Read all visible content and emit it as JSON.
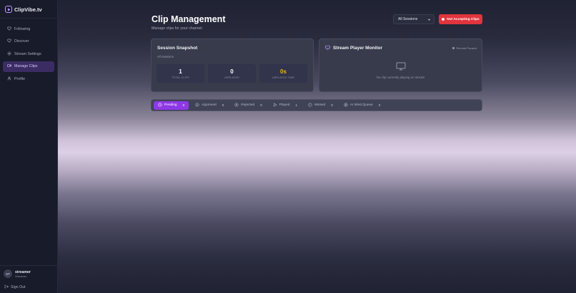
{
  "app": {
    "name": "ClipVibe.tv"
  },
  "sidebar": {
    "items": [
      {
        "label": "Following",
        "icon": "heart-icon",
        "active": false
      },
      {
        "label": "Discover",
        "icon": "heart-icon",
        "active": false
      },
      {
        "label": "Stream Settings",
        "icon": "gear-icon",
        "active": false
      },
      {
        "label": "Manage Clips",
        "icon": "video-icon",
        "active": true
      },
      {
        "label": "Profile",
        "icon": "user-icon",
        "active": false
      }
    ],
    "user": {
      "initials": "ST",
      "name": "streamer",
      "role": "Streamer"
    },
    "signout_label": "Sign Out"
  },
  "header": {
    "title": "Clip Management",
    "subtitle": "Manage clips for your channel",
    "session_select": {
      "value": "All Sessions"
    },
    "accept_button": {
      "label": "Not Accepting Clips",
      "color": "#e0353d"
    }
  },
  "session_snapshot": {
    "title": "Session Snapshot",
    "subtitle": "All Sessions",
    "stats": [
      {
        "value": "1",
        "label": "TOTAL CLIPS"
      },
      {
        "value": "0",
        "label": "UNPLAYED"
      },
      {
        "value": "0s",
        "label": "UNPLAYED TIME",
        "color": "#f2b51e"
      }
    ]
  },
  "monitor": {
    "title": "Stream Player Monitor",
    "badge": "Remote Paused",
    "empty_text": "No clip currently playing on stream"
  },
  "tabs": [
    {
      "label": "Pending",
      "count": "0",
      "icon": "clock-icon",
      "active": true
    },
    {
      "label": "Approved",
      "count": "0",
      "icon": "check-circle-icon",
      "active": false
    },
    {
      "label": "Rejected",
      "count": "0",
      "icon": "x-circle-icon",
      "active": false
    },
    {
      "label": "Played",
      "count": "1",
      "icon": "play-icon",
      "active": false
    },
    {
      "label": "Missed",
      "count": "0",
      "icon": "alert-circle-icon",
      "active": false
    },
    {
      "label": "AI Mind Queue",
      "count": "0",
      "icon": "brain-icon",
      "active": false
    }
  ],
  "colors": {
    "accent": "#8f38e8",
    "danger": "#e0353d",
    "highlight": "#f2b51e"
  }
}
